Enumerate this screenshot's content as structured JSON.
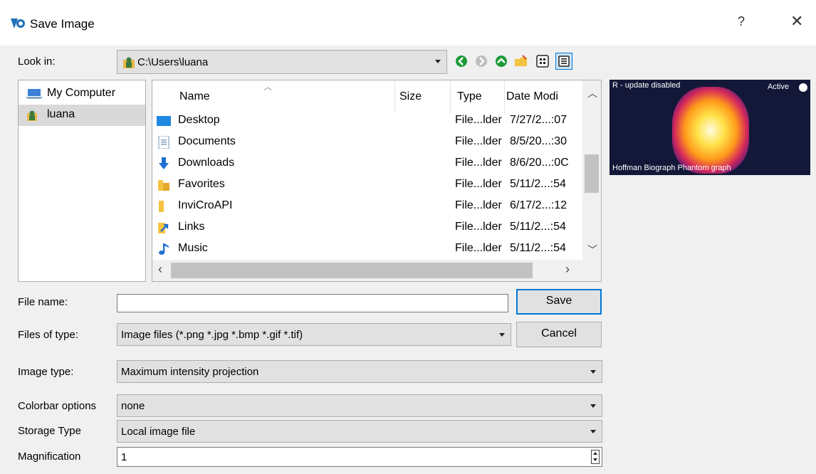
{
  "window": {
    "title": "Save Image",
    "help": "?",
    "close": "✕"
  },
  "look_in": {
    "label": "Look in:",
    "path": "C:\\Users\\luana"
  },
  "sidebar": {
    "items": [
      {
        "label": "My Computer"
      },
      {
        "label": "luana"
      }
    ]
  },
  "file_list": {
    "columns": {
      "name": "Name",
      "size": "Size",
      "type": "Type",
      "date": "Date Modi"
    },
    "rows": [
      {
        "name": "Desktop",
        "type": "File...lder",
        "date": "7/27/2...:07",
        "icon": "desktop-folder-icon"
      },
      {
        "name": "Documents",
        "type": "File...lder",
        "date": "8/5/20...:30",
        "icon": "documents-folder-icon"
      },
      {
        "name": "Downloads",
        "type": "File...lder",
        "date": "8/6/20...:0C",
        "icon": "downloads-folder-icon"
      },
      {
        "name": "Favorites",
        "type": "File...lder",
        "date": "5/11/2...:54",
        "icon": "favorites-folder-icon"
      },
      {
        "name": "InviCroAPI",
        "type": "File...lder",
        "date": "6/17/2...:12",
        "icon": "folder-icon"
      },
      {
        "name": "Links",
        "type": "File...lder",
        "date": "5/11/2...:54",
        "icon": "links-folder-icon"
      },
      {
        "name": "Music",
        "type": "File...lder",
        "date": "5/11/2...:54",
        "icon": "music-folder-icon"
      }
    ]
  },
  "preview": {
    "top_left": "R - update disabled",
    "top_right": "Active",
    "bottom": "Hoffman Biograph Phantom graph"
  },
  "file_name": {
    "label": "File name:",
    "value": ""
  },
  "files_of_type": {
    "label": "Files of type:",
    "value": "Image files (*.png *.jpg *.bmp *.gif *.tif)"
  },
  "buttons": {
    "save": "Save",
    "cancel": "Cancel"
  },
  "image_type": {
    "label": "Image type:",
    "value": "Maximum intensity projection"
  },
  "colorbar": {
    "label": "Colorbar options",
    "value": "none"
  },
  "storage": {
    "label": "Storage Type",
    "value": "Local image file"
  },
  "magnification": {
    "label": "Magnification",
    "value": "1"
  },
  "colors": {
    "accent": "#0078d7",
    "nav_green": "#1e9b3a",
    "folder_yellow": "#f5c342"
  }
}
